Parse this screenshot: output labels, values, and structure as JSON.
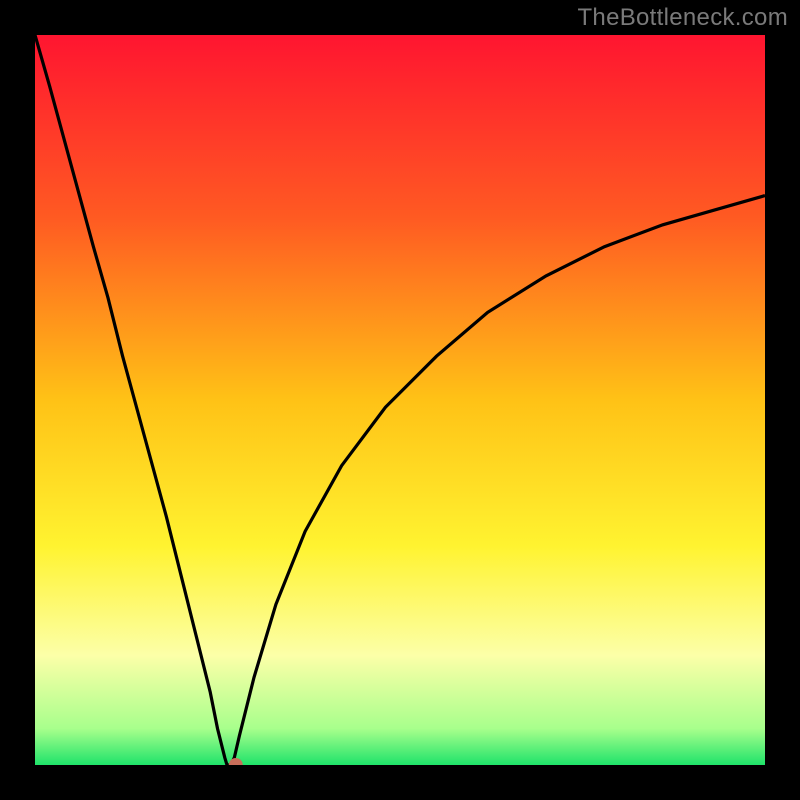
{
  "watermark": "TheBottleneck.com",
  "chart_data": {
    "type": "line",
    "title": "",
    "xlabel": "",
    "ylabel": "",
    "xlim": [
      0,
      100
    ],
    "ylim": [
      0,
      100
    ],
    "grid": false,
    "legend": false,
    "x": [
      0,
      2,
      5,
      8,
      10,
      12,
      15,
      18,
      20,
      22,
      24,
      25,
      26,
      26.3,
      26.8,
      27.3,
      28,
      30,
      33,
      37,
      42,
      48,
      55,
      62,
      70,
      78,
      86,
      93,
      100
    ],
    "values": [
      100,
      93,
      82,
      71,
      64,
      56,
      45,
      34,
      26,
      18,
      10,
      5,
      1,
      0,
      0,
      1,
      4,
      12,
      22,
      32,
      41,
      49,
      56,
      62,
      67,
      71,
      74,
      76,
      78
    ],
    "curve_min_x": 26.5,
    "marker": {
      "x": 27.5,
      "y": 0,
      "color": "#c86e5a",
      "radius": 7
    },
    "gradient_stops": [
      {
        "pos": 0.0,
        "color": "#ff1530"
      },
      {
        "pos": 0.25,
        "color": "#ff5a22"
      },
      {
        "pos": 0.5,
        "color": "#ffc216"
      },
      {
        "pos": 0.7,
        "color": "#fff330"
      },
      {
        "pos": 0.85,
        "color": "#fcffa8"
      },
      {
        "pos": 0.95,
        "color": "#a8ff8c"
      },
      {
        "pos": 1.0,
        "color": "#1fe36a"
      }
    ]
  }
}
